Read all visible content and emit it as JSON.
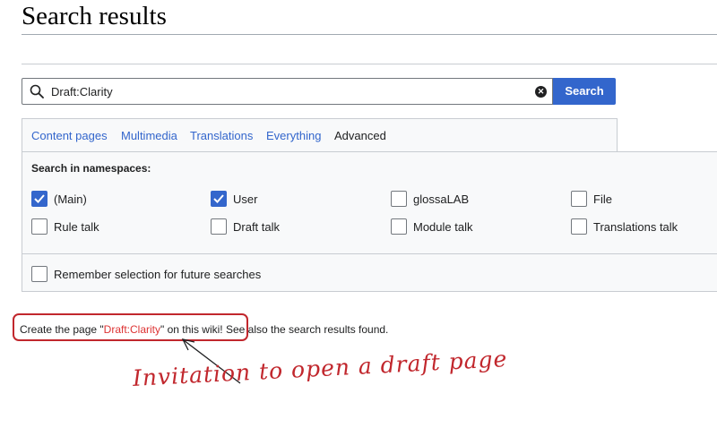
{
  "page": {
    "title": "Search results"
  },
  "search": {
    "query": "Draft:Clarity",
    "button_label": "Search",
    "icon": "search-icon",
    "clear_icon": "clear-icon"
  },
  "tabs": [
    {
      "label": "Content pages",
      "active": false
    },
    {
      "label": "Multimedia",
      "active": false
    },
    {
      "label": "Translations",
      "active": false
    },
    {
      "label": "Everything",
      "active": false
    },
    {
      "label": "Advanced",
      "active": true
    }
  ],
  "namespaces": {
    "heading": "Search in namespaces:",
    "items": [
      {
        "label": "(Main)",
        "checked": true
      },
      {
        "label": "User",
        "checked": true
      },
      {
        "label": "glossaLAB",
        "checked": false
      },
      {
        "label": "File",
        "checked": false
      },
      {
        "label": "Rule talk",
        "checked": false
      },
      {
        "label": "Draft talk",
        "checked": false
      },
      {
        "label": "Module talk",
        "checked": false
      },
      {
        "label": "Translations talk",
        "checked": false
      }
    ],
    "remember_label": "Remember selection for future searches",
    "remember_checked": false
  },
  "create": {
    "prefix": "Create the page \"",
    "link": "Draft:Clarity",
    "middle": "\" on this wiki! ",
    "suffix": "See also the search results found."
  },
  "annotation": {
    "text": "Invitation to open a draft page",
    "color": "#c1272d"
  },
  "colors": {
    "accent": "#3366cc",
    "redlink": "#d33"
  }
}
